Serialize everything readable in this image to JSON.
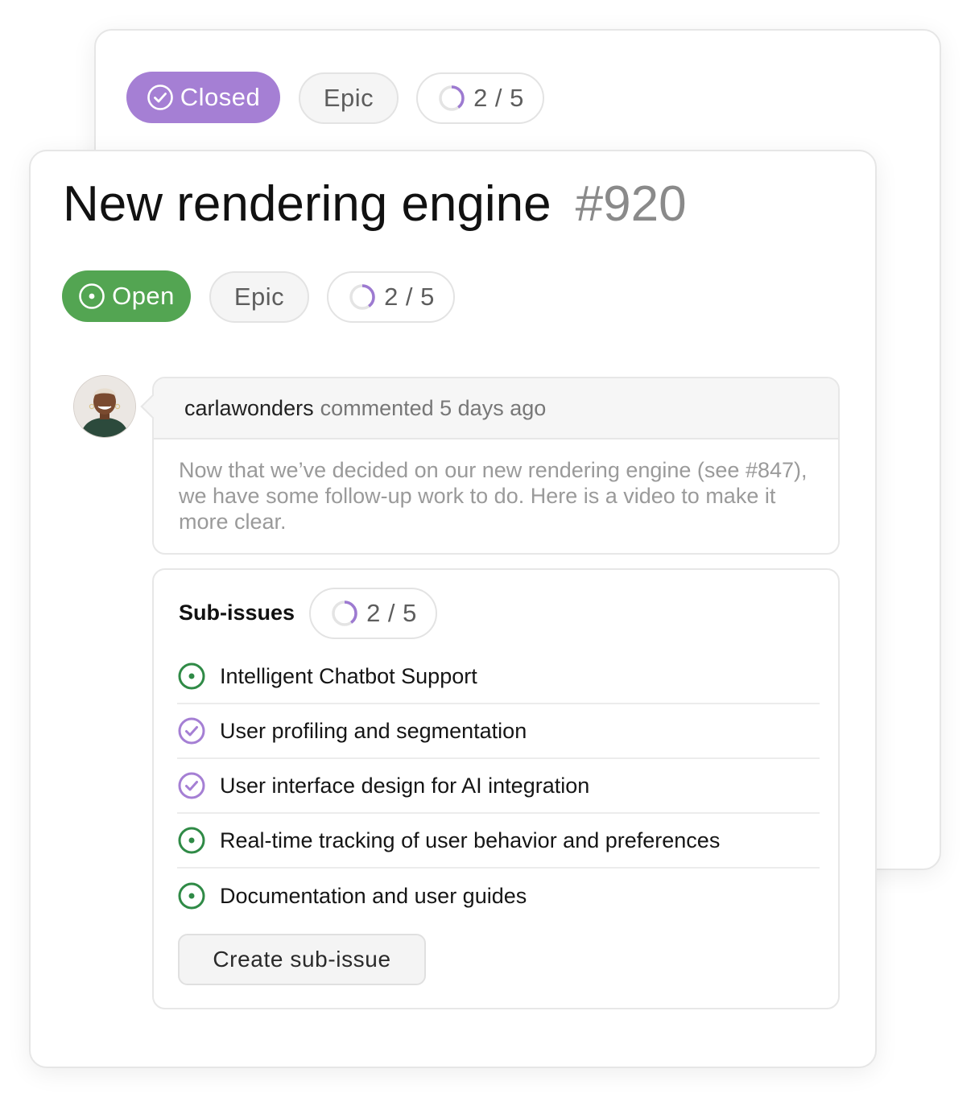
{
  "back_card": {
    "status_label": "Closed",
    "type_label": "Epic",
    "progress_label": "2 / 5",
    "progress_fraction": 0.4
  },
  "issue": {
    "title": "New rendering engine",
    "number": "#920",
    "status_label": "Open",
    "type_label": "Epic",
    "progress_label": "2 / 5",
    "progress_fraction": 0.4
  },
  "comment": {
    "author": "carlawonders",
    "meta": "commented 5 days ago",
    "body": "Now that we’ve decided on our new rendering engine (see #847), we have some follow-up work to do. Here is a video to make it more clear."
  },
  "sub_issues": {
    "heading": "Sub-issues",
    "progress_label": "2 / 5",
    "progress_fraction": 0.4,
    "items": [
      {
        "label": "Intelligent Chatbot Support",
        "state": "open"
      },
      {
        "label": "User profiling and segmentation",
        "state": "closed"
      },
      {
        "label": "User interface design for AI integration",
        "state": "closed"
      },
      {
        "label": "Real-time tracking of user behavior and preferences",
        "state": "open"
      },
      {
        "label": "Documentation and user guides",
        "state": "open"
      }
    ],
    "create_button": "Create sub-issue"
  },
  "colors": {
    "open_green": "#53a552",
    "open_icon_green": "#2f8a46",
    "closed_purple": "#a57fd4",
    "progress_purple": "#9d7ad1"
  },
  "icons": {
    "open": "open-issue-icon",
    "closed": "closed-check-icon",
    "progress": "progress-ring-icon"
  }
}
